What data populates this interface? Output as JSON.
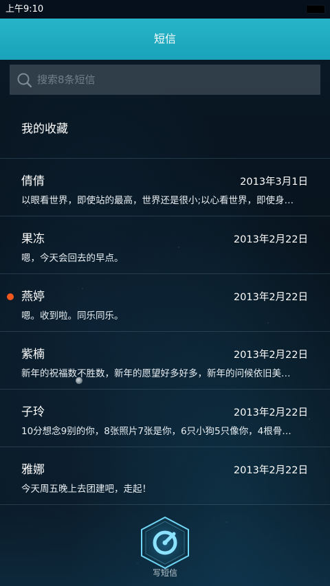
{
  "status_bar": {
    "time": "上午9:10"
  },
  "header": {
    "title": "短信"
  },
  "search": {
    "placeholder": "搜索8条短信",
    "icon": "search-icon"
  },
  "favorites": {
    "label": "我的收藏"
  },
  "conversations": [
    {
      "name": "倩倩",
      "date": "2013年3月1日",
      "preview": "以眼看世界，即使站的最高，世界还是很小;以心看世界，即使身…",
      "unread": false
    },
    {
      "name": "果冻",
      "date": "2013年2月22日",
      "preview": "嗯，今天会回去的早点。",
      "unread": false
    },
    {
      "name": "燕婷",
      "date": "2013年2月22日",
      "preview": "嗯。收到啦。同乐同乐。",
      "unread": true
    },
    {
      "name": "紫楠",
      "date": "2013年2月22日",
      "preview": "新年的祝福数不胜数，新年的愿望好多好多，新年的问候依旧美…",
      "unread": false
    },
    {
      "name": "子玲",
      "date": "2013年2月22日",
      "preview": "10分想念9别的你，8张照片7张是你，6只小狗5只像你，4根骨…",
      "unread": false
    },
    {
      "name": "雅娜",
      "date": "2013年2月22日",
      "preview": "今天周五晚上去团建吧，走起！",
      "unread": false
    }
  ],
  "compose": {
    "label": "写短信",
    "icon": "compose-icon"
  },
  "colors": {
    "title_bar": "#1fabc1",
    "unread_dot": "#f0581e",
    "compose_glow": "#5fd0f0"
  }
}
